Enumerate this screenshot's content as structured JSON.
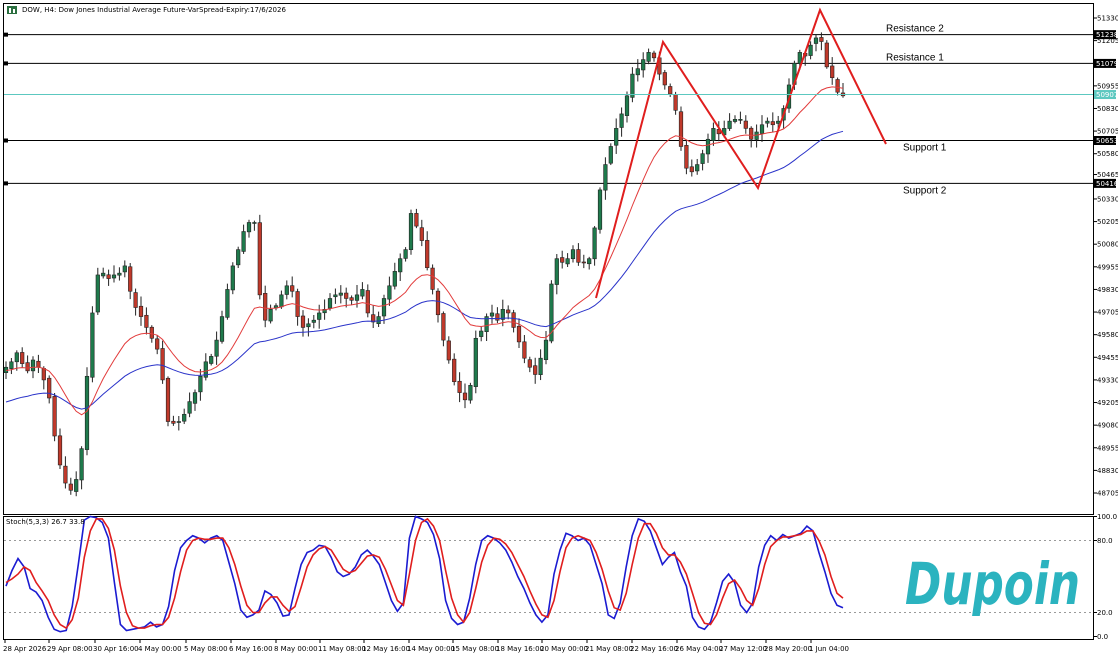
{
  "header": {
    "title": "DOW, H4:  Dow Jones Industrial Average Future-VarSpread-Expiry:17/6/2026",
    "stoch_label": "Stoch(5,3,3) 26.7 33.8"
  },
  "colors": {
    "bull": "#1f7a4c",
    "bear": "#c0392b",
    "wick": "#222222",
    "ema_fast": "#e23b3b",
    "ema_slow": "#2a33c9",
    "bid_line": "#5cc8c0",
    "pattern": "#e01e1e",
    "stoch_main": "#1b1bd1",
    "stoch_signal": "#e01e1e",
    "brand": "#2bb3bf"
  },
  "brand": {
    "name": "Dupoin",
    "icon": "dupoin-logo"
  },
  "levels": [
    {
      "name": "Resistance 2",
      "price": 51238,
      "tag": "51238"
    },
    {
      "name": "Resistance 1",
      "price": 51079,
      "tag": "51079"
    },
    {
      "name": "Support 1",
      "price": 50653,
      "tag": "50653"
    },
    {
      "name": "Support 2",
      "price": 50416,
      "tag": "50416"
    }
  ],
  "bid": {
    "price": 50907,
    "tag": "50907"
  },
  "chart_data": [
    {
      "type": "candlestick",
      "title": "DOW, H4",
      "y_ticks": [
        51330,
        51205,
        50955,
        50830,
        50705,
        50580,
        50465,
        50330,
        50205,
        50080,
        49955,
        49830,
        49705,
        49580,
        49455,
        49330,
        49205,
        49080,
        48955,
        48830,
        48705
      ],
      "ylim": [
        48620,
        51430
      ],
      "x_ticks": [
        "28 Apr 2026",
        "29 Apr 08:00",
        "30 Apr 16:00",
        "4 May 00:00",
        "5 May 08:00",
        "6 May 16:00",
        "8 May 00:00",
        "11 May 08:00",
        "12 May 16:00",
        "14 May 00:00",
        "15 May 08:00",
        "18 May 16:00",
        "20 May 00:00",
        "21 May 08:00",
        "22 May 16:00",
        "26 May 04:00",
        "27 May 12:00",
        "28 May 20:00",
        "1 Jun 04:00"
      ],
      "closes": [
        49400,
        49430,
        49480,
        49420,
        49380,
        49440,
        49400,
        49330,
        49230,
        49020,
        48860,
        48760,
        48720,
        48780,
        48950,
        49350,
        49700,
        49910,
        49920,
        49890,
        49910,
        49920,
        49960,
        49820,
        49730,
        49680,
        49620,
        49560,
        49500,
        49330,
        49100,
        49090,
        49100,
        49140,
        49210,
        49260,
        49350,
        49430,
        49460,
        49550,
        49680,
        49830,
        49960,
        50050,
        50150,
        50200,
        50200,
        49800,
        49660,
        49720,
        49740,
        49800,
        49850,
        49820,
        49680,
        49620,
        49640,
        49660,
        49700,
        49720,
        49780,
        49800,
        49810,
        49780,
        49770,
        49800,
        49830,
        49700,
        49650,
        49680,
        49780,
        49850,
        49930,
        50000,
        50050,
        50250,
        50180,
        50100,
        49950,
        49830,
        49690,
        49550,
        49440,
        49320,
        49260,
        49220,
        49300,
        49560,
        49600,
        49680,
        49700,
        49660,
        49720,
        49700,
        49620,
        49540,
        49450,
        49400,
        49360,
        49450,
        49550,
        49860,
        50000,
        49980,
        50000,
        50050,
        49980,
        49980,
        50000,
        50170,
        50380,
        50520,
        50620,
        50720,
        50800,
        50900,
        51020,
        51050,
        51100,
        51140,
        51110,
        51020,
        50960,
        50910,
        50820,
        50620,
        50500,
        50480,
        50520,
        50580,
        50660,
        50720,
        50690,
        50720,
        50760,
        50770,
        50770,
        50720,
        50660,
        50700,
        50740,
        50760,
        50740,
        50760,
        50830,
        50960,
        51080,
        51140,
        51120,
        51180,
        51220,
        51200,
        51060,
        51000,
        50920,
        50900
      ],
      "ema_fast_series": "computed: EMA(20) of closes",
      "ema_slow_series": "computed: EMA(50) of closes"
    },
    {
      "type": "line",
      "title": "Stoch(5,3,3)",
      "y_ticks": [
        100.0,
        80.0,
        20.0,
        0.0
      ],
      "ylim": [
        0,
        100
      ],
      "series": [
        {
          "name": "Main",
          "values": [
            42,
            55,
            65,
            58,
            40,
            37,
            30,
            16,
            6,
            4,
            5,
            25,
            60,
            97,
            100,
            99,
            95,
            82,
            45,
            10,
            5,
            6,
            7,
            8,
            12,
            8,
            10,
            25,
            55,
            74,
            80,
            84,
            82,
            78,
            82,
            84,
            80,
            62,
            44,
            22,
            16,
            18,
            22,
            38,
            35,
            28,
            17,
            18,
            40,
            60,
            70,
            72,
            76,
            75,
            66,
            54,
            50,
            52,
            58,
            68,
            72,
            67,
            60,
            45,
            30,
            21,
            28,
            82,
            100,
            98,
            95,
            85,
            65,
            30,
            15,
            10,
            12,
            32,
            60,
            80,
            84,
            82,
            78,
            72,
            62,
            50,
            40,
            28,
            18,
            12,
            18,
            52,
            72,
            86,
            84,
            80,
            82,
            76,
            60,
            44,
            18,
            15,
            28,
            58,
            84,
            98,
            96,
            88,
            74,
            60,
            66,
            70,
            54,
            42,
            16,
            8,
            6,
            12,
            28,
            46,
            52,
            45,
            26,
            20,
            28,
            58,
            76,
            84,
            80,
            85,
            82,
            84,
            86,
            92,
            88,
            70,
            54,
            36,
            26,
            24
          ]
        },
        {
          "name": "Signal",
          "values": [
            45,
            48,
            52,
            58,
            55,
            45,
            38,
            30,
            18,
            10,
            7,
            14,
            32,
            66,
            88,
            98,
            98,
            90,
            72,
            42,
            20,
            9,
            7,
            7,
            9,
            10,
            10,
            16,
            32,
            54,
            72,
            80,
            82,
            81,
            81,
            82,
            82,
            74,
            60,
            42,
            26,
            20,
            20,
            28,
            33,
            33,
            26,
            21,
            25,
            41,
            58,
            68,
            73,
            75,
            72,
            64,
            56,
            53,
            55,
            61,
            67,
            68,
            66,
            56,
            43,
            30,
            26,
            52,
            80,
            95,
            98,
            92,
            80,
            55,
            32,
            18,
            12,
            20,
            40,
            62,
            76,
            82,
            81,
            77,
            70,
            60,
            50,
            38,
            27,
            18,
            16,
            30,
            54,
            74,
            82,
            84,
            82,
            80,
            70,
            56,
            38,
            24,
            22,
            36,
            60,
            82,
            94,
            94,
            86,
            74,
            68,
            68,
            62,
            52,
            36,
            20,
            11,
            10,
            18,
            32,
            44,
            47,
            40,
            30,
            26,
            40,
            60,
            75,
            80,
            83,
            83,
            84,
            85,
            88,
            88,
            80,
            68,
            50,
            36,
            32
          ]
        }
      ]
    }
  ]
}
